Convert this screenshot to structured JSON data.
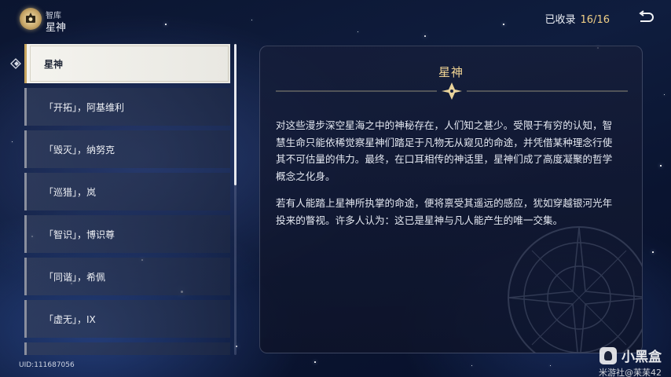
{
  "header": {
    "section": "智库",
    "title": "星神",
    "collected_label": "已收录",
    "collected_count": "16/16"
  },
  "list": {
    "items": [
      {
        "label": "星神",
        "active": true
      },
      {
        "label": "「开拓」，阿基维利",
        "active": false
      },
      {
        "label": "「毁灭」，纳努克",
        "active": false
      },
      {
        "label": "「巡猎」，岚",
        "active": false
      },
      {
        "label": "「智识」，博识尊",
        "active": false
      },
      {
        "label": "「同谐」，希佩",
        "active": false
      },
      {
        "label": "「虚无」，IX",
        "active": false
      },
      {
        "label": "",
        "active": false
      }
    ]
  },
  "detail": {
    "title": "星神",
    "paragraph1": "对这些漫步深空星海之中的神秘存在，人们知之甚少。受限于有穷的认知，智慧生命只能依稀觉察星神们踏足于凡物无从窥见的命途，并凭借某种理念行使其不可估量的伟力。最终，在口耳相传的神话里，星神们成了高度凝聚的哲学概念之化身。",
    "paragraph2": "若有人能踏上星神所执掌的命途，便将禀受其遥远的感应，犹如穿越银河光年投来的瞥视。许多人认为：这已是星神与凡人能产生的唯一交集。"
  },
  "footer": {
    "uid": "UID:111687056",
    "watermark_brand": "小黑盒",
    "watermark_author": "米游社@苿苿42"
  },
  "icons": {
    "emblem": "library-emblem-icon",
    "back": "back-arrow-icon",
    "selector": "selection-arrow-icon"
  },
  "colors": {
    "accent_gold": "#f1cf86",
    "active_item_bg": "#f4f3ee",
    "panel_bg": "#161e3a"
  }
}
